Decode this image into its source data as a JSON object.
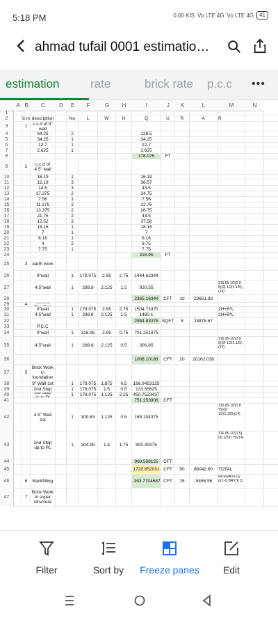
{
  "status_bar": {
    "time": "5:18 PM",
    "speed": "0.00 K/S",
    "net1": "Vo LTE 4G",
    "net2": "Vo LTE 4G",
    "battery": "41"
  },
  "app_bar": {
    "title": "ahmad tufail 0001 estimatio…"
  },
  "tabs": [
    {
      "label": "estimation",
      "active": true
    },
    {
      "label": "rate",
      "active": false
    },
    {
      "label": "brick rate",
      "active": false
    },
    {
      "label": "p.c.c",
      "active": false
    }
  ],
  "more_label": "•••",
  "sheet": {
    "columns": [
      "A",
      "B",
      "C",
      "D",
      "E",
      "F",
      "G",
      "H",
      "I",
      "J",
      "K",
      "L",
      "M",
      "N"
    ],
    "rows": [
      {
        "n": "1",
        "h": 6,
        "cells": {}
      },
      {
        "n": "2",
        "h": 9,
        "cells": {
          "B": "Sr.no",
          "C": "description",
          "E": "No",
          "F": "L",
          "G": "W",
          "H": "H",
          "I": "Q",
          "J": "U",
          "K": "R",
          "L": "A",
          "M": "R"
        }
      },
      {
        "n": "3",
        "h": 14,
        "cells": {
          "B": "1",
          "C": "c.c.d of 9\" wall"
        }
      },
      {
        "n": "4",
        "h": 8,
        "cells": {
          "C": "64.25",
          "E": "2",
          "I": "128.5"
        }
      },
      {
        "n": "5",
        "h": 8,
        "cells": {
          "C": "34.25",
          "E": "1",
          "I": "34.25"
        }
      },
      {
        "n": "6",
        "h": 8,
        "cells": {
          "C": "12.7",
          "E": "1",
          "I": "12.7"
        }
      },
      {
        "n": "7",
        "h": 8,
        "cells": {
          "C": "2.625",
          "E": "1",
          "I": "2.625"
        }
      },
      {
        "n": "8",
        "h": 8,
        "cells": {
          "I": "178.075",
          "J": "FT"
        },
        "green": "I"
      },
      {
        "n": "9",
        "h": 22,
        "cells": {
          "B": "2",
          "C": "c.c.d of 4.5\" wall"
        }
      },
      {
        "n": "10",
        "h": 8,
        "cells": {
          "C": "16.19",
          "E": "1",
          "I": "16.19"
        }
      },
      {
        "n": "11",
        "h": 8,
        "cells": {
          "C": "12.19",
          "E": "3",
          "I": "36.57"
        }
      },
      {
        "n": "12",
        "h": 8,
        "cells": {
          "C": "14.5",
          "E": "3",
          "I": "43.5"
        }
      },
      {
        "n": "13",
        "h": 8,
        "cells": {
          "C": "17.375",
          "E": "2",
          "I": "34.75"
        }
      },
      {
        "n": "14",
        "h": 8,
        "cells": {
          "C": "7.56",
          "E": "1",
          "I": "7.56"
        }
      },
      {
        "n": "15",
        "h": 8,
        "cells": {
          "C": "11.375",
          "E": "2",
          "I": "22.75"
        }
      },
      {
        "n": "16",
        "h": 8,
        "cells": {
          "C": "13.375",
          "E": "2",
          "I": "26.75"
        }
      },
      {
        "n": "17",
        "h": 8,
        "cells": {
          "C": "21.75",
          "E": "2",
          "I": "43.5"
        }
      },
      {
        "n": "18",
        "h": 8,
        "cells": {
          "C": "12.52",
          "E": "3",
          "I": "37.56"
        }
      },
      {
        "n": "19",
        "h": 8,
        "cells": {
          "C": "18.16",
          "E": "1",
          "I": "18.16"
        }
      },
      {
        "n": "20",
        "h": 8,
        "cells": {
          "C": "7",
          "E": "1",
          "I": "7"
        }
      },
      {
        "n": "21",
        "h": 8,
        "cells": {
          "C": "6.16",
          "E": "1",
          "I": "6.16"
        }
      },
      {
        "n": "22",
        "h": 8,
        "cells": {
          "C": "4",
          "E": "2",
          "I": "8.75"
        }
      },
      {
        "n": "23",
        "h": 8,
        "cells": {
          "C": "7.75",
          "E": "1",
          "I": "7.75"
        }
      },
      {
        "n": "24",
        "h": 8,
        "cells": {
          "I": "316.95",
          "J": "FT"
        },
        "green": "I"
      },
      {
        "n": "25",
        "h": 18,
        "cells": {
          "B": "3",
          "C": "earth work"
        }
      },
      {
        "n": "26",
        "h": 15,
        "cells": {
          "C": "9\"wall",
          "E": "1",
          "F": "178.075",
          "G": "2.95",
          "H": "2.75",
          "I": "1444.63344"
        }
      },
      {
        "n": "27",
        "h": 20,
        "cells": {
          "C": "4.5\"wall",
          "E": "1",
          "F": "288.8",
          "G": "2.125",
          "H": "1.5",
          "I": "920.55",
          "M": "316.95-1/2(2.9 5)(9) 1/2(2.125)(14)"
        }
      },
      {
        "n": "28",
        "h": 11,
        "cells": {
          "I": "2365.18344",
          "J": "CFT",
          "K": "10",
          "L": "23651.83"
        },
        "green": "I"
      },
      {
        "n": "29",
        "h": 6,
        "cells": {
          "B": "4",
          "C": "Termite Proofing"
        }
      },
      {
        "n": "30",
        "h": 8,
        "cells": {
          "C": "9\"wall",
          "E": "1",
          "F": "178.075",
          "G": "2.95",
          "H": "2.75",
          "I": "1504.73375",
          "M": "2H+B*L"
        }
      },
      {
        "n": "31",
        "h": 8,
        "cells": {
          "C": "4.5\"wall",
          "E": "1",
          "F": "288.8",
          "G": "2.125",
          "H": "1.5",
          "I": "1480.1",
          "M": "2H+B*L"
        }
      },
      {
        "n": "32",
        "h": 9,
        "cells": {
          "I": "2984.83375",
          "J": "SQFT",
          "K": "8",
          "L": "23878.67"
        },
        "green": "I"
      },
      {
        "n": "33",
        "h": 8,
        "cells": {
          "C": "P.C.C"
        }
      },
      {
        "n": "34",
        "h": 10,
        "cells": {
          "C": "9\"wall",
          "E": "1",
          "F": "316.95",
          "G": "2.95",
          "H": "0.75",
          "I": "701.251875"
        }
      },
      {
        "n": "35",
        "h": 26,
        "cells": {
          "C": "4.5\"wall",
          "E": "1",
          "F": "288.8",
          "G": "2.125",
          "H": "0.5",
          "I": "306.85",
          "M": "316.95-1/2(2.9 5)(9) 1/2(2.125)(14)"
        }
      },
      {
        "n": "36",
        "h": 14,
        "cells": {
          "I": "1008.10188",
          "J": "CFT",
          "K": "20",
          "L": "20162.038"
        },
        "green": "I"
      },
      {
        "n": "37",
        "h": 24,
        "cells": {
          "B": "5",
          "C": "Brick Work in foundation"
        }
      },
      {
        "n": "38",
        "h": 8,
        "cells": {
          "C": "9\" Wall 1st",
          "E": "1",
          "F": "178.075",
          "G": "1.875",
          "H": "0.5",
          "I": "166.9453125"
        }
      },
      {
        "n": "39",
        "h": 8,
        "cells": {
          "C": "2nd Step",
          "E": "1",
          "F": "178.075",
          "G": "1.5",
          "H": "0.5",
          "I": "133.55625"
        }
      },
      {
        "n": "40",
        "h": 8,
        "cells": {
          "C": "3rd Step up to PL",
          "E": "1",
          "F": "178.075",
          "G": "1.125",
          "H": "2.25",
          "I": "450.7523437"
        }
      },
      {
        "n": "41",
        "h": 8,
        "cells": {
          "I": "751.253906",
          "J": "CFT"
        },
        "green": "I"
      },
      {
        "n": "42",
        "h": 40,
        "cells": {
          "C": "4.5\" Wall 1st",
          "E": "1",
          "F": "300.63",
          "G": "1.125",
          "H": "0.5",
          "I": "169.104375",
          "M": "316.95-1/2(1.8 75)(9) 1/2(1.125)(14)"
        }
      },
      {
        "n": "43",
        "h": 40,
        "cells": {
          "C": "2nd Step up to PL",
          "E": "1",
          "F": "304.95",
          "G": "1.5",
          "H": "1.75",
          "I": "800.49375",
          "M": "316.95-1/2(1.5)(9) 1/2(0.75)(14)"
        }
      },
      {
        "n": "44",
        "h": 8,
        "cells": {
          "I": "969.598125",
          "J": "CFT"
        },
        "green": "I"
      },
      {
        "n": "45",
        "h": 14,
        "cells": {
          "I": "1720.852031",
          "J": "CFT",
          "K": "50",
          "L": "86042.60",
          "M": "TOTAL"
        },
        "yellow": "I"
      },
      {
        "n": "46",
        "h": 20,
        "cells": {
          "B": "6",
          "C": "Backfilling",
          "I": "-363.7704687",
          "J": "CFT",
          "K": "15",
          "L": "-5456.56",
          "M": "excavation-Cy pcc-Q BRICK Q"
        },
        "green": "I"
      },
      {
        "n": "47",
        "h": 26,
        "cells": {
          "B": "7",
          "C": "Brick Work in super structure"
        }
      }
    ]
  },
  "toolbar": [
    {
      "label": "Filter",
      "icon": "filter-icon",
      "active": false
    },
    {
      "label": "Sort by",
      "icon": "sort-icon",
      "active": false
    },
    {
      "label": "Freeze panes",
      "icon": "freeze-panes-icon",
      "active": true
    },
    {
      "label": "Edit",
      "icon": "edit-icon",
      "active": false
    }
  ],
  "colors": {
    "accent_green": "#188038",
    "accent_blue": "#1a73e8",
    "highlight_green": "#d9ead3",
    "highlight_yellow": "#fff2b2"
  }
}
